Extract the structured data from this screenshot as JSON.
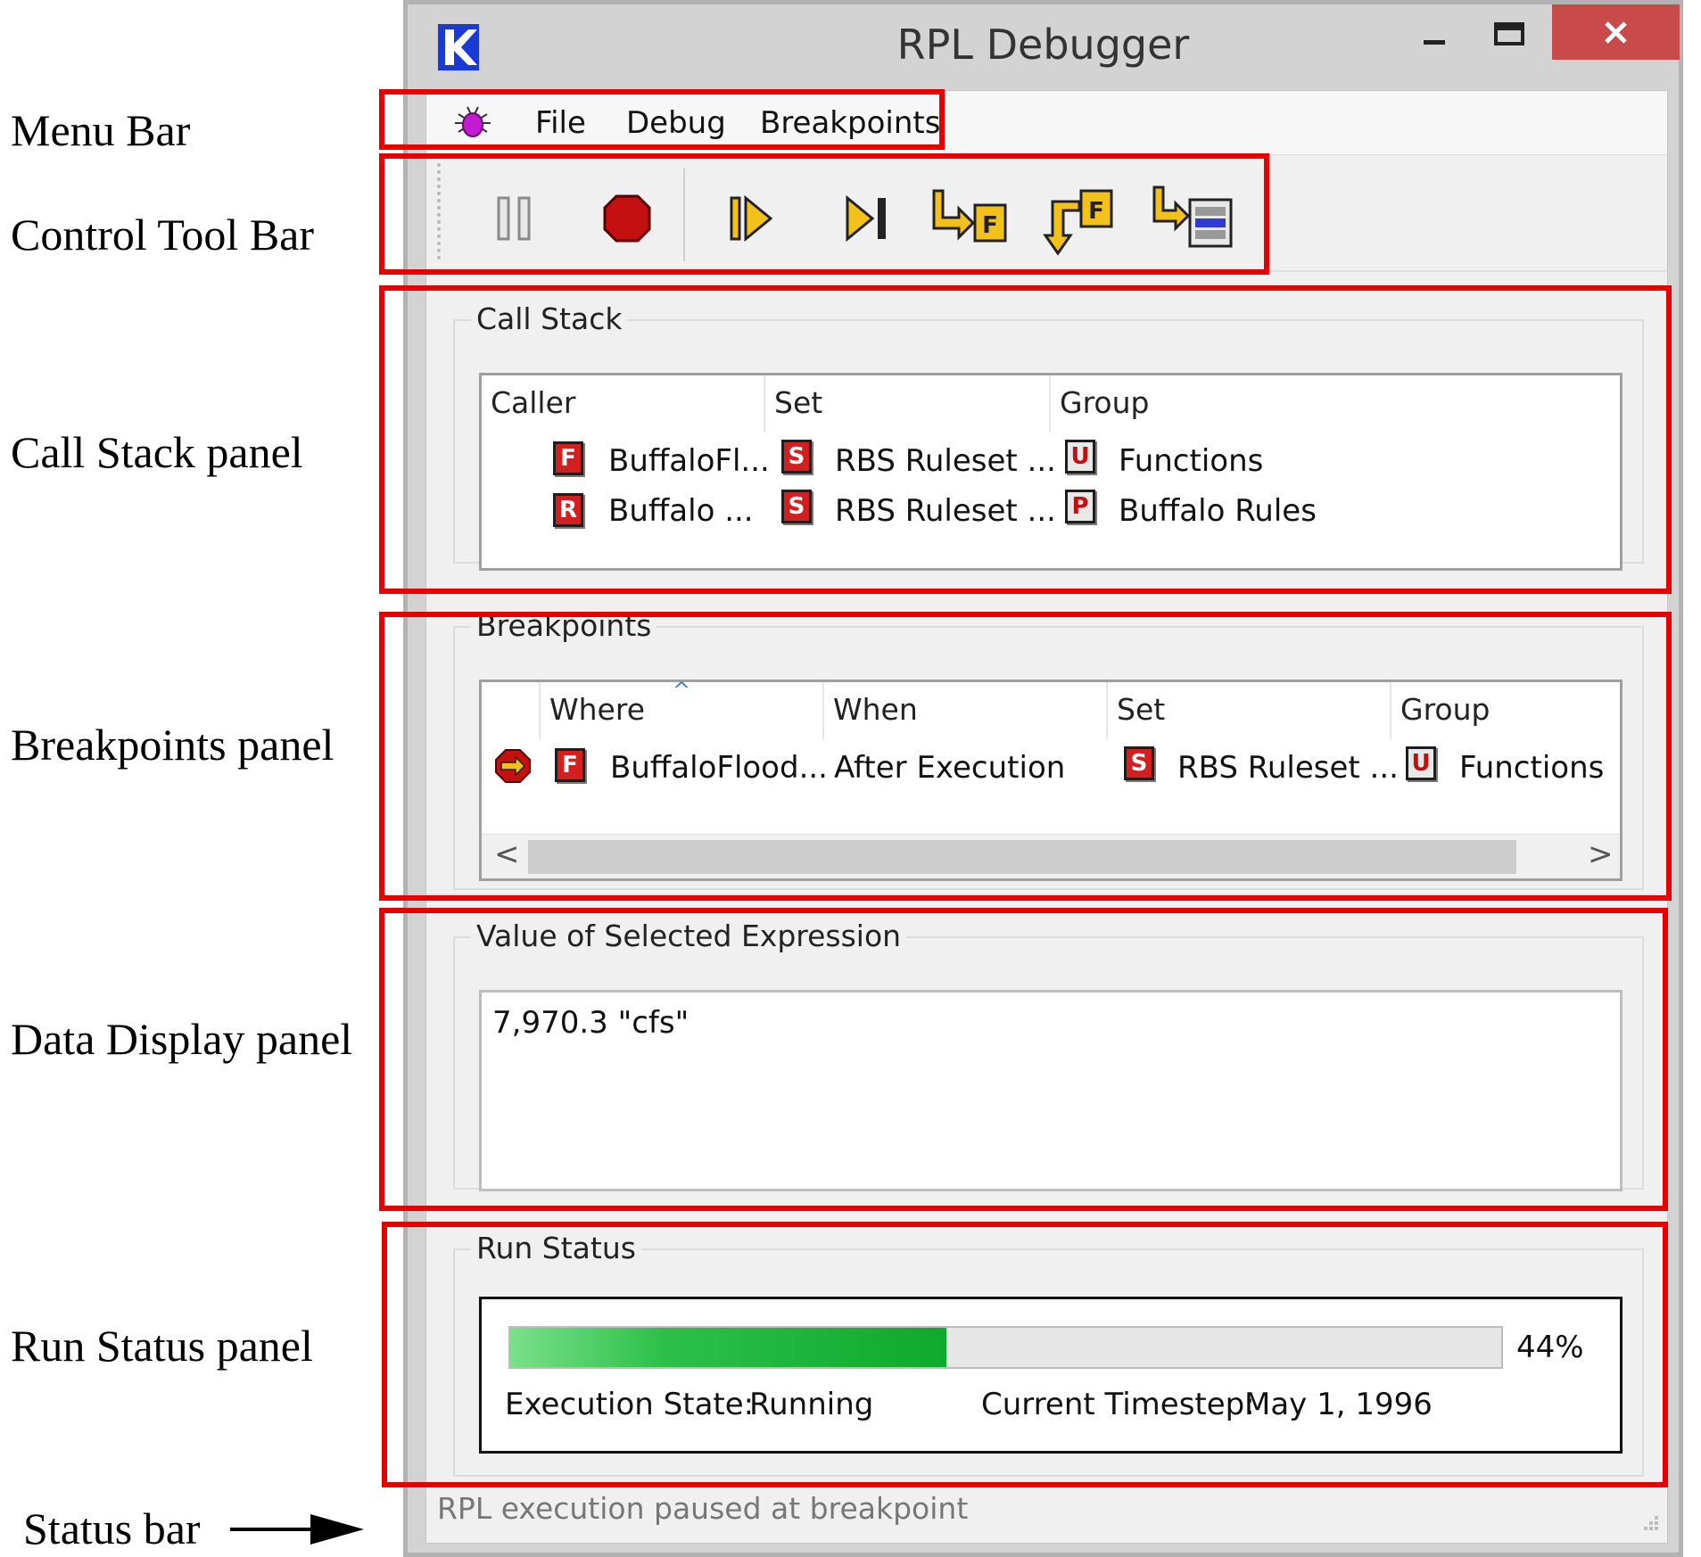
{
  "annotations": {
    "menu_bar": "Menu Bar",
    "control_tool_bar": "Control Tool Bar",
    "call_stack_panel": "Call Stack panel",
    "breakpoints_panel": "Breakpoints panel",
    "data_display_panel": "Data Display panel",
    "run_status_panel": "Run Status panel",
    "status_bar": "Status bar"
  },
  "window": {
    "title": "RPL Debugger",
    "close_glyph": "✕"
  },
  "menu": {
    "icon": "bug-icon",
    "items": [
      "File",
      "Debug",
      "Breakpoints"
    ]
  },
  "toolbar": {
    "buttons": [
      "pause-icon",
      "stop-icon",
      "continue-icon",
      "step-icon",
      "step-into-function-icon",
      "step-out-function-icon",
      "step-to-end-icon"
    ],
    "step_into_letter": "F",
    "step_out_letter": "F"
  },
  "call_stack": {
    "title": "Call Stack",
    "columns": [
      "Caller",
      "Set",
      "Group"
    ],
    "rows": [
      {
        "caller_badge": "F",
        "caller": "BuffaloFl...",
        "set_badge": "S",
        "set": "RBS Ruleset ...",
        "group_badge": "U",
        "group": "Functions"
      },
      {
        "caller_badge": "R",
        "caller": "Buffalo ...",
        "set_badge": "S",
        "set": "RBS Ruleset ...",
        "group_badge": "P",
        "group": "Buffalo Rules"
      }
    ]
  },
  "breakpoints": {
    "title": "Breakpoints",
    "columns": [
      "",
      "Where",
      "When",
      "Set",
      "Group"
    ],
    "sort_glyph": "^",
    "rows": [
      {
        "where_badge": "F",
        "where": "BuffaloFlood...",
        "when": "After Execution",
        "set_badge": "S",
        "set": "RBS Ruleset ...",
        "group_badge": "U",
        "group": "Functions"
      }
    ],
    "scroll_left": "<",
    "scroll_right": ">"
  },
  "data_display": {
    "title": "Value of Selected Expression",
    "value": "7,970.3 \"cfs\""
  },
  "run_status": {
    "title": "Run Status",
    "progress": 0.44,
    "progress_label": "44%",
    "execution_state_label": "Execution State:",
    "execution_state": "Running",
    "timestep_label": "Current Timestep:",
    "timestep": "May 1, 1996"
  },
  "status_bar": {
    "text": "RPL execution paused at breakpoint"
  },
  "colors": {
    "highlight_red": "#e60000",
    "progress_green": "#0ea92f",
    "close_button": "#c84a4a",
    "icon_red": "#d21f1f"
  }
}
